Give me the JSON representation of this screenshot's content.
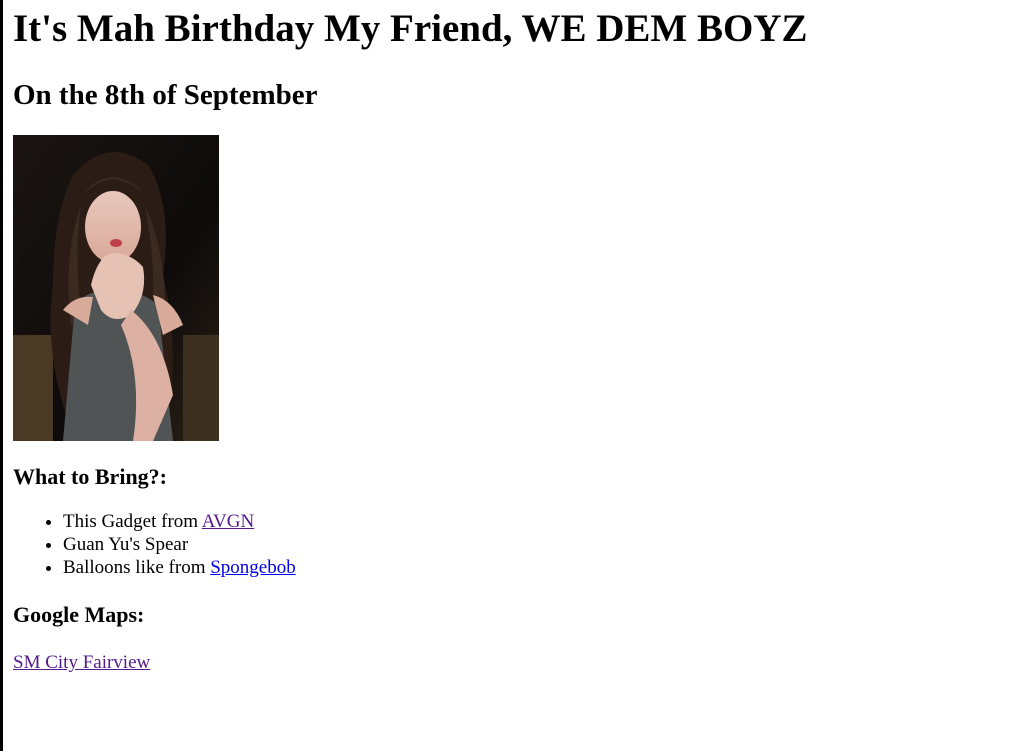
{
  "page": {
    "title": "It's Mah Birthday My Friend, WE DEM BOYZ",
    "subtitle": "On the 8th of September"
  },
  "image": {
    "alt": ""
  },
  "bring": {
    "heading": "What to Bring?:",
    "items": [
      {
        "prefix": "This Gadget from ",
        "link": "AVGN"
      },
      {
        "prefix": "Guan Yu's Spear",
        "link": ""
      },
      {
        "prefix": "Balloons like from ",
        "link": "Spongebob"
      }
    ]
  },
  "maps": {
    "heading": "Google Maps:",
    "link": "SM City Fairview"
  },
  "colors": {
    "visited_link": "#551a8b",
    "unvisited_link": "#0000ee"
  }
}
